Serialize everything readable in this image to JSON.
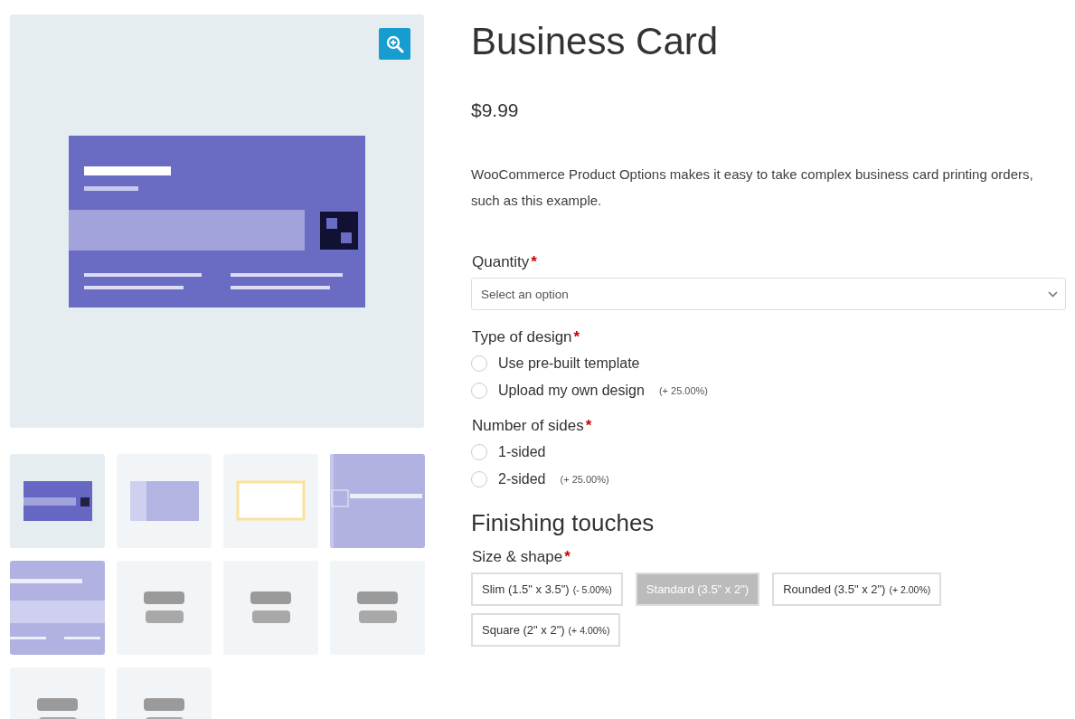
{
  "required_mark": "*",
  "product": {
    "title": "Business Card",
    "price": "$9.99",
    "description": "WooCommerce Product Options makes it easy to take complex business card printing orders, such as this example."
  },
  "fields": [
    {
      "kind": "select",
      "label": "Quantity",
      "required": true,
      "placeholder": "Select an option"
    },
    {
      "kind": "radio",
      "label": "Type of design",
      "required": true,
      "options": [
        {
          "label": "Use pre-built template",
          "selected": false
        },
        {
          "label": "Upload my own design",
          "price": "(+ 25.00%)",
          "selected": false
        }
      ]
    },
    {
      "kind": "radio",
      "label": "Number of sides",
      "required": true,
      "options": [
        {
          "label": "1-sided",
          "selected": false
        },
        {
          "label": "2-sided",
          "price": "(+ 25.00%)",
          "selected": false
        }
      ]
    },
    {
      "kind": "heading",
      "label": "Finishing touches"
    },
    {
      "kind": "buttons",
      "label": "Size & shape",
      "required": true,
      "options": [
        {
          "label": "Slim (1.5\" x 3.5\")",
          "price": "(- 5.00%)",
          "selected": false
        },
        {
          "label": "Standard (3.5\" x 2\")",
          "selected": true
        },
        {
          "label": "Rounded (3.5\" x 2\")",
          "price": "(+ 2.00%)",
          "selected": false
        },
        {
          "label": "Square (2\" x 2\")",
          "price": "(+ 4.00%)",
          "selected": false
        }
      ]
    }
  ]
}
